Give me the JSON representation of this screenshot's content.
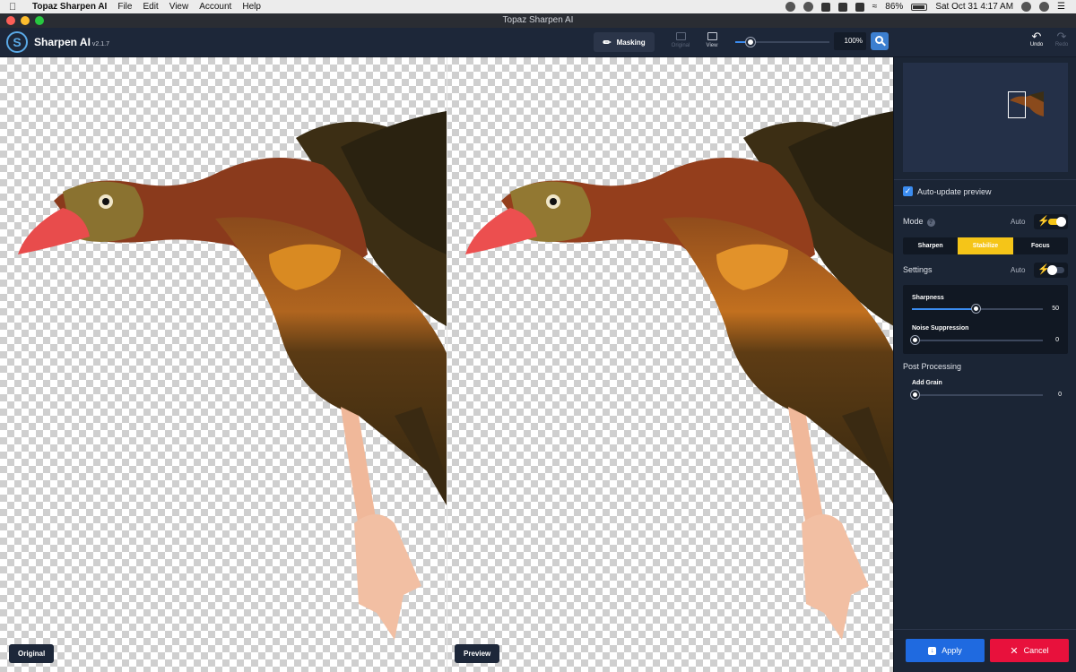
{
  "menubar": {
    "app_name": "Topaz Sharpen AI",
    "menus": [
      "File",
      "Edit",
      "View",
      "Account",
      "Help"
    ],
    "battery": "86%",
    "datetime": "Sat Oct 31  4:17 AM"
  },
  "window": {
    "title": "Topaz Sharpen AI"
  },
  "toolbar": {
    "app_name": "Sharpen AI",
    "version": "v2.1.7",
    "masking_label": "Masking",
    "original_label": "Original",
    "view_label": "View",
    "zoom_value": "100%",
    "zoom_level": 0.12,
    "undo_label": "Undo",
    "redo_label": "Redo"
  },
  "canvas": {
    "original_label": "Original",
    "preview_label": "Preview"
  },
  "panel": {
    "auto_update_label": "Auto-update preview",
    "auto_update_checked": true,
    "mode_label": "Mode",
    "auto_label": "Auto",
    "mode_auto_on": true,
    "mode_tabs": [
      "Sharpen",
      "Stabilize",
      "Focus"
    ],
    "mode_active": "Stabilize",
    "settings_label": "Settings",
    "settings_auto_on": false,
    "sliders": {
      "sharpness": {
        "label": "Sharpness",
        "value": "50"
      },
      "noise": {
        "label": "Noise Suppression",
        "value": "0"
      },
      "grain": {
        "label": "Add Grain",
        "value": "0"
      }
    },
    "post_processing_label": "Post Processing",
    "apply_label": "Apply",
    "cancel_label": "Cancel"
  },
  "colors": {
    "accent_blue": "#3b8cf0",
    "active_tab": "#f5c518",
    "cancel_red": "#e8113c"
  }
}
